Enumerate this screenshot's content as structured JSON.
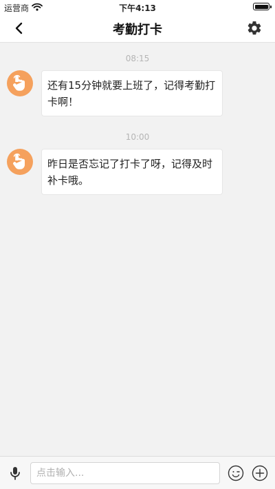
{
  "status_bar": {
    "carrier": "运营商",
    "time": "下午4:13"
  },
  "nav": {
    "title": "考勤打卡"
  },
  "messages": [
    {
      "time": "08:15",
      "text": "还有15分钟就要上班了，记得考勤打卡啊！"
    },
    {
      "time": "10:00",
      "text": "昨日是否忘记了打卡了呀，记得及时补卡哦。"
    }
  ],
  "input": {
    "placeholder": "点击输入..."
  },
  "colors": {
    "avatar_bg": "#f5a15d",
    "page_bg": "#f2f2f2",
    "timestamp": "#b5b5b5"
  },
  "icons": {
    "back": "chevron-left-icon",
    "settings": "gear-icon",
    "mic": "microphone-icon",
    "emoji": "smiley-icon",
    "add": "plus-circle-icon",
    "avatar": "tap-hand-icon",
    "wifi": "wifi-icon",
    "battery": "battery-icon"
  }
}
